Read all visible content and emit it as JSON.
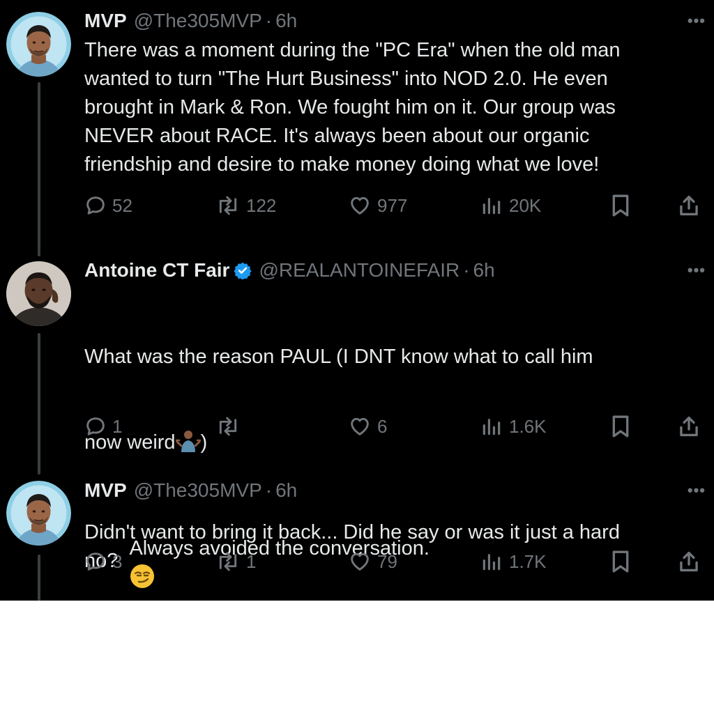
{
  "colors": {
    "background": "#000000",
    "text_primary": "#e7e9ea",
    "text_secondary": "#71767b",
    "verified_badge": "#1d9bf0",
    "avatar_ring": "#8ecfe6",
    "lower_area": "#ffffff"
  },
  "tweets": [
    {
      "display_name": "MVP",
      "handle": "@The305MVP",
      "separator": "·",
      "time": "6h",
      "more_label": "•••",
      "text": "There was a moment during the \"PC Era\" when the old man\nwanted to turn \"The Hurt Business\" into NOD 2.0. He even\nbrought in Mark & Ron. We fought him on it. Our group was\nNEVER about RACE. It's always been about our organic\nfriendship and desire to make money doing what we love!",
      "replies": "52",
      "reposts": "122",
      "likes": "977",
      "views": "20K",
      "icons": [
        "reply-icon",
        "repost-icon",
        "like-icon",
        "views-icon",
        "bookmark-icon",
        "share-icon"
      ]
    },
    {
      "display_name": "Antoine CT Fair",
      "verified": true,
      "handle": "@REALANTOINEFAIR",
      "separator": "·",
      "time": "6h",
      "more_label": "•••",
      "text_line1": "What was the reason PAUL (I DNT know what to call him",
      "text_line2_before": "now weird",
      "emoji": "person-shrugging-emoji",
      "text_line2_after": ")",
      "text_rest": "Didn't want to bring it back... Did he say or was it just a hard\nno?",
      "replies": "1",
      "reposts": "",
      "likes": "6",
      "views": "1.6K",
      "icons": [
        "reply-icon",
        "repost-icon",
        "like-icon",
        "views-icon",
        "bookmark-icon",
        "share-icon"
      ]
    },
    {
      "display_name": "MVP",
      "handle": "@The305MVP",
      "separator": "·",
      "time": "6h",
      "more_label": "•••",
      "text": "Always avoided the conversation.",
      "emoji": "smirking-face-emoji",
      "replies": "3",
      "reposts": "1",
      "likes": "79",
      "views": "1.7K",
      "icons": [
        "reply-icon",
        "repost-icon",
        "like-icon",
        "views-icon",
        "bookmark-icon",
        "share-icon"
      ]
    }
  ]
}
